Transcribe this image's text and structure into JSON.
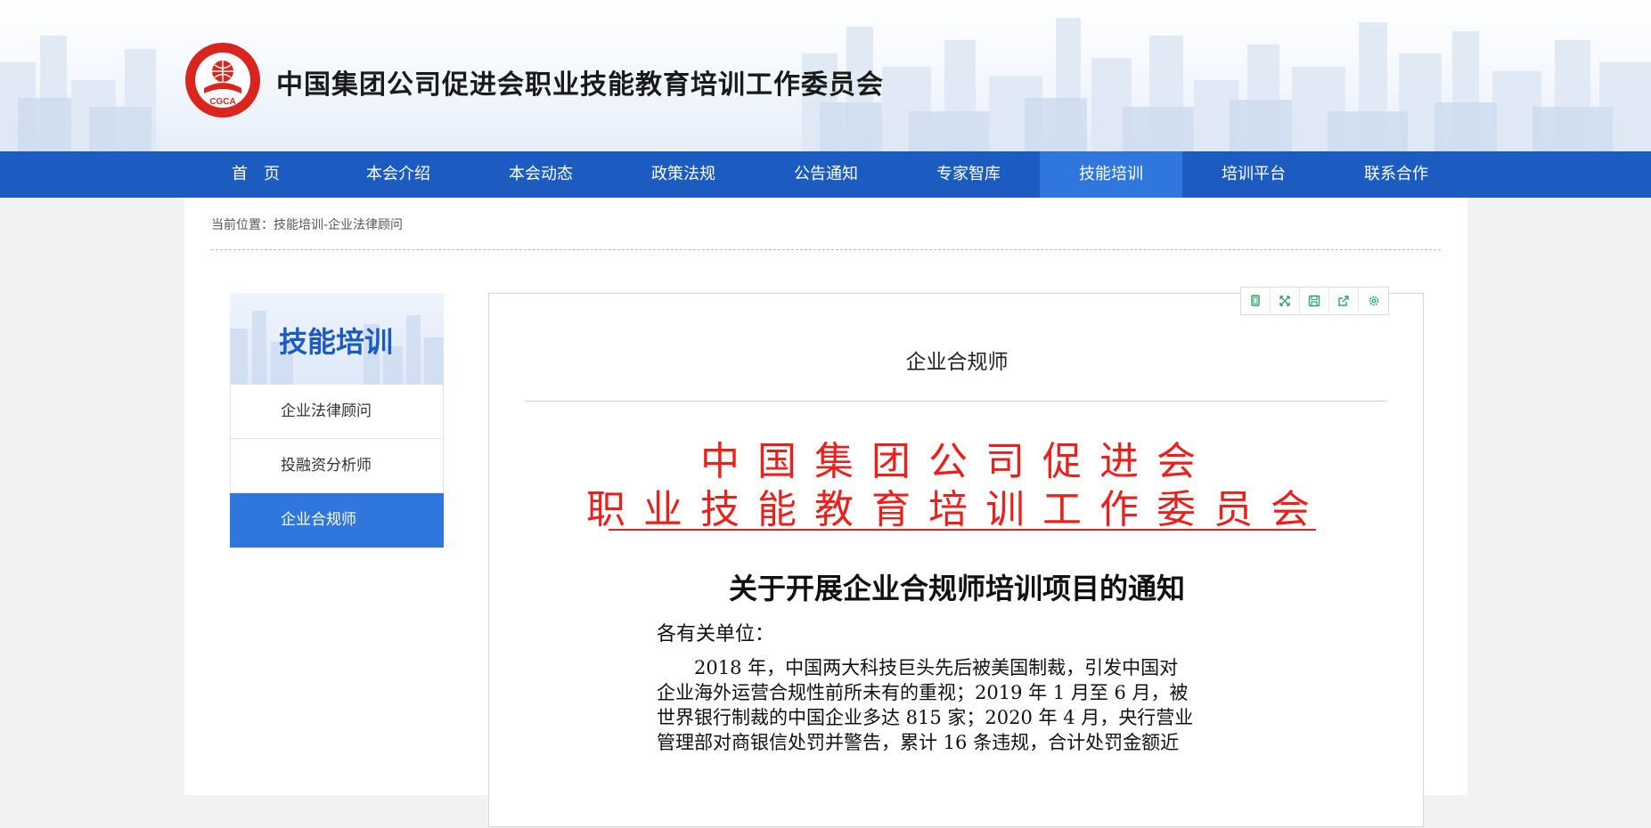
{
  "header": {
    "logo_text": "CGCA",
    "logo_ring_text": "CHINA GROUP COMPANIES ASSOCIATION",
    "title": "中国集团公司促进会职业技能教育培训工作委员会"
  },
  "nav": {
    "items": [
      {
        "label": "首　页"
      },
      {
        "label": "本会介绍"
      },
      {
        "label": "本会动态"
      },
      {
        "label": "政策法规"
      },
      {
        "label": "公告通知"
      },
      {
        "label": "专家智库"
      },
      {
        "label": "技能培训"
      },
      {
        "label": "培训平台"
      },
      {
        "label": "联系合作"
      }
    ],
    "active_index": 6
  },
  "breadcrumb": "当前位置：技能培训-企业法律顾问",
  "sidebar": {
    "title": "技能培训",
    "items": [
      {
        "label": "企业法律顾问"
      },
      {
        "label": "投融资分析师"
      },
      {
        "label": "企业合规师"
      }
    ],
    "active_index": 2
  },
  "toolbar": {
    "icons": [
      "copy-icon",
      "fullscreen-icon",
      "save-icon",
      "share-icon",
      "settings-icon"
    ]
  },
  "article": {
    "title": "企业合规师"
  },
  "document": {
    "org_line1": "中国集团公司促进会",
    "org_line2": "职业技能教育培训工作委员会",
    "title": "关于开展企业合规师培训项目的通知",
    "salutation": "各有关单位：",
    "body_lines": [
      "　　2018 年，中国两大科技巨头先后被美国制裁，引发中国对",
      "企业海外运营合规性前所未有的重视；2019 年 1 月至 6 月，被",
      "世界银行制裁的中国企业多达 815 家；2020 年 4 月，央行营业",
      "管理部对商银信处罚并警告，累计 16 条违规，合计处罚金额近"
    ]
  },
  "colors": {
    "nav_bg": "#1c5bbf",
    "nav_active": "#2f76dd",
    "doc_red": "#e8211c",
    "toolbar_icon": "#2ea36b"
  }
}
